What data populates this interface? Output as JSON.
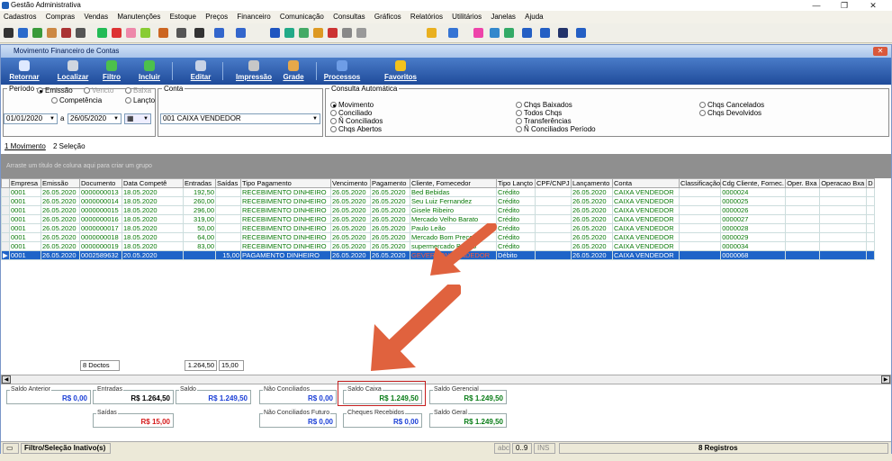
{
  "app": {
    "title": "Gestão Administrativa",
    "min": "—",
    "max": "❐",
    "close": "✕"
  },
  "menu": [
    "Cadastros",
    "Compras",
    "Vendas",
    "Manutenções",
    "Estoque",
    "Preços",
    "Financeiro",
    "Comunicação",
    "Consultas",
    "Gráficos",
    "Relatórios",
    "Utilitários",
    "Janelas",
    "Ajuda"
  ],
  "window": {
    "title": "Movimento Financeiro de Contas",
    "close": "✕"
  },
  "ribbon": {
    "retornar": "Retornar",
    "localizar": "Localizar",
    "filtro": "Filtro",
    "incluir": "Incluir",
    "editar": "Editar",
    "impressao": "Impressão",
    "grade": "Grade",
    "processos": "Processos",
    "favoritos": "Favoritos"
  },
  "filters": {
    "periodo_legend": "Período",
    "emissao": "Emissão",
    "vencto": "Vencto",
    "baixa": "Baixa",
    "competencia": "Competência",
    "lancto": "Lançto",
    "date_from": "01/01/2020",
    "date_sep": "a",
    "date_to": "26/05/2020",
    "conta_legend": "Conta",
    "conta_value": "001  CAIXA VENDEDOR",
    "consulta_legend": "Consulta Automática",
    "opts_col1": [
      "Movimento",
      "Conciliado",
      "Ñ Conciliados",
      "Chqs Abertos"
    ],
    "opts_col2": [
      "Chqs Baixados",
      "Todos Chqs",
      "Transferências",
      "Ñ Conciliados Período"
    ],
    "opts_col3": [
      "Chqs Cancelados",
      "Chqs Devolvidos"
    ]
  },
  "tabs": {
    "t1": "1 Movimento",
    "t2": "2 Seleção"
  },
  "group_hint": "Arraste um título de coluna aqui para criar um grupo",
  "columns": [
    "",
    "Empresa",
    "Emissão",
    "Documento",
    "Data Competê",
    "Entradas",
    "Saídas",
    "Tipo Pagamento",
    "Vencimento",
    "Pagamento",
    "Cliente, Fornecedor",
    "Tipo Lançto",
    "CPF/CNPJ",
    "Lançamento",
    "Conta",
    "Classificação",
    "Cdg Cliente, Fornec.",
    "Oper. Bxa",
    "Operacao Bxa",
    "D"
  ],
  "rows": [
    [
      "",
      "0001",
      "26.05.2020",
      "0000000013",
      "18.05.2020",
      "192,50",
      "",
      "RECEBIMENTO DINHEIRO",
      "26.05.2020",
      "26.05.2020",
      "Bed Bebidas",
      "Crédito",
      "",
      "26.05.2020",
      "CAIXA VENDEDOR",
      "",
      "0000024",
      "",
      "",
      ""
    ],
    [
      "",
      "0001",
      "26.05.2020",
      "0000000014",
      "18.05.2020",
      "260,00",
      "",
      "RECEBIMENTO DINHEIRO",
      "26.05.2020",
      "26.05.2020",
      "Seu Luiz Fernandez",
      "Crédito",
      "",
      "26.05.2020",
      "CAIXA VENDEDOR",
      "",
      "0000025",
      "",
      "",
      ""
    ],
    [
      "",
      "0001",
      "26.05.2020",
      "0000000015",
      "18.05.2020",
      "296,00",
      "",
      "RECEBIMENTO DINHEIRO",
      "26.05.2020",
      "26.05.2020",
      "Gisele Ribeiro",
      "Crédito",
      "",
      "26.05.2020",
      "CAIXA VENDEDOR",
      "",
      "0000026",
      "",
      "",
      ""
    ],
    [
      "",
      "0001",
      "26.05.2020",
      "0000000016",
      "18.05.2020",
      "319,00",
      "",
      "RECEBIMENTO DINHEIRO",
      "26.05.2020",
      "26.05.2020",
      "Mercado Velho Barato",
      "Crédito",
      "",
      "26.05.2020",
      "CAIXA VENDEDOR",
      "",
      "0000027",
      "",
      "",
      ""
    ],
    [
      "",
      "0001",
      "26.05.2020",
      "0000000017",
      "18.05.2020",
      "50,00",
      "",
      "RECEBIMENTO DINHEIRO",
      "26.05.2020",
      "26.05.2020",
      "Paulo Leão",
      "Crédito",
      "",
      "26.05.2020",
      "CAIXA VENDEDOR",
      "",
      "0000028",
      "",
      "",
      ""
    ],
    [
      "",
      "0001",
      "26.05.2020",
      "0000000018",
      "18.05.2020",
      "64,00",
      "",
      "RECEBIMENTO DINHEIRO",
      "26.05.2020",
      "26.05.2020",
      "Mercado Bom Preço",
      "Crédito",
      "",
      "26.05.2020",
      "CAIXA VENDEDOR",
      "",
      "0000029",
      "",
      "",
      ""
    ],
    [
      "",
      "0001",
      "26.05.2020",
      "0000000019",
      "18.05.2020",
      "83,00",
      "",
      "RECEBIMENTO DINHEIRO",
      "26.05.2020",
      "26.05.2020",
      "supermercado Barato",
      "Crédito",
      "",
      "26.05.2020",
      "CAIXA VENDEDOR",
      "",
      "0000034",
      "",
      "",
      ""
    ],
    [
      "▶",
      "0001",
      "26.05.2020",
      "0002589632",
      "20.05.2020",
      "",
      "15,00",
      "PAGAMENTO DINHEIRO",
      "26.05.2020",
      "26.05.2020",
      "GEVERSON VENDEDOR",
      "Débito",
      "",
      "26.05.2020",
      "CAIXA VENDEDOR",
      "",
      "0000068",
      "",
      "",
      ""
    ]
  ],
  "footer": {
    "docs": "8 Doctos",
    "entradas": "1.264,50",
    "saidas": "15,00"
  },
  "totals": {
    "saldo_anterior": {
      "label": "Saldo Anterior",
      "value": "R$ 0,00"
    },
    "entradas": {
      "label": "Entradas",
      "value": "R$ 1.264,50"
    },
    "saidas": {
      "label": "Saídas",
      "value": "R$ 15,00"
    },
    "saldo": {
      "label": "Saldo",
      "value": "R$ 1.249,50"
    },
    "nao_conciliados": {
      "label": "Não Conciliados",
      "value": "R$ 0,00"
    },
    "nao_conciliados_futuro": {
      "label": "Não Conciliados Futuro",
      "value": "R$ 0,00"
    },
    "saldo_caixa": {
      "label": "Saldo Caixa",
      "value": "R$ 1.249,50"
    },
    "cheques_recebidos": {
      "label": "Cheques Recebidos",
      "value": "R$ 0,00"
    },
    "saldo_gerencial": {
      "label": "Saldo Gerencial",
      "value": "R$ 1.249,50"
    },
    "saldo_geral": {
      "label": "Saldo Geral",
      "value": "R$ 1.249,50"
    }
  },
  "status": {
    "filter": "Filtro/Seleção Inativo(s)",
    "abc": "abc",
    "nums": "0..9",
    "ins": "INS",
    "registros": "8 Registros"
  },
  "colors": {
    "ribbon": "#2a5cae",
    "selected_row": "#1e64c8",
    "arrow": "#e0623e",
    "green_text": "#0a7a0a"
  }
}
